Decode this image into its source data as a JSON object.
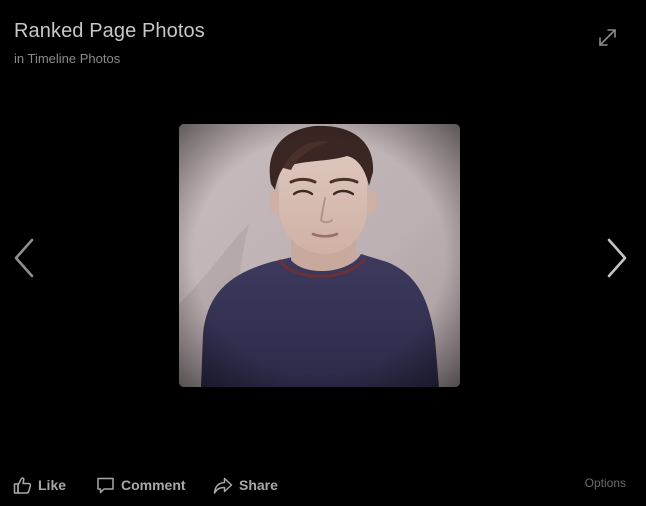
{
  "header": {
    "title": "Ranked Page Photos",
    "subtitle": "in Timeline Photos"
  },
  "icons": {
    "expand": "expand-icon",
    "previous": "chevron-left-icon",
    "next": "chevron-right-icon",
    "like": "thumbs-up-icon",
    "comment": "speech-bubble-icon",
    "share": "share-arrow-icon"
  },
  "photo": {
    "subject": "person-portrait"
  },
  "actions": {
    "like_label": "Like",
    "comment_label": "Comment",
    "share_label": "Share",
    "options_label": "Options"
  },
  "colors": {
    "background": "#000000",
    "title_text": "#c8c8c8",
    "subtitle_text": "#8a8a8a",
    "action_text": "#a8a8a8",
    "options_text": "#6c6c6c"
  }
}
